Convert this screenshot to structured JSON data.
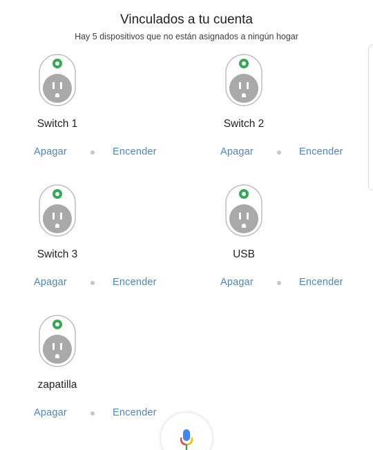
{
  "header": {
    "title": "Vinculados a tu cuenta",
    "subtitle": "Hay 5 dispositivos que no están asignados a ningún hogar"
  },
  "devices": [
    {
      "name": "Switch 1",
      "off_label": "Apagar",
      "on_label": "Encender"
    },
    {
      "name": "Switch 2",
      "off_label": "Apagar",
      "on_label": "Encender"
    },
    {
      "name": "Switch 3",
      "off_label": "Apagar",
      "on_label": "Encender"
    },
    {
      "name": "USB",
      "off_label": "Apagar",
      "on_label": "Encender"
    },
    {
      "name": "zapatilla",
      "off_label": "Apagar",
      "on_label": "Encender"
    }
  ],
  "icons": {
    "device": "smart-plug-icon",
    "status": "power-led-icon",
    "assistant": "microphone-icon"
  },
  "colors": {
    "action_text": "#4a86c5",
    "status_led": "#34a853",
    "plug_face": "#a9a9a9"
  }
}
